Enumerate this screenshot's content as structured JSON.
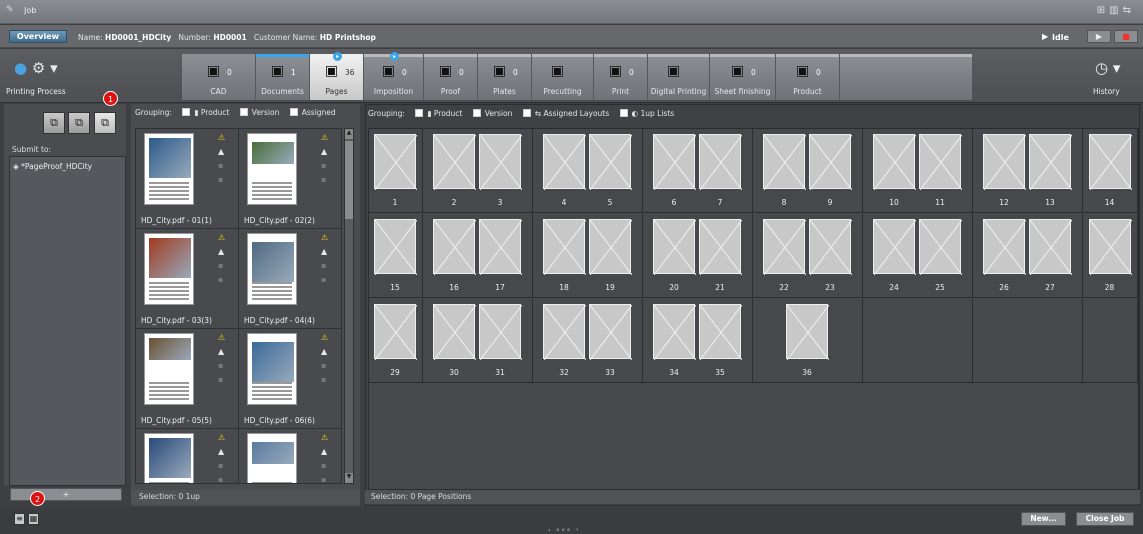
{
  "window": {
    "title": "Job"
  },
  "info": {
    "overview_label": "Overview",
    "name_label": "Name:",
    "name_value": "HD0001_HDCity",
    "number_label": "Number:",
    "number_value": "HD0001",
    "customer_label": "Customer Name:",
    "customer_value": "HD Printshop",
    "status": "Idle"
  },
  "left_button": {
    "label": "Printing Process"
  },
  "history_button": {
    "label": "History"
  },
  "process_steps": [
    {
      "label": "CAD",
      "count": "0",
      "icon": "cad-icon"
    },
    {
      "label": "Documents",
      "count": "1",
      "icon": "documents-icon"
    },
    {
      "label": "Pages",
      "count": "36",
      "icon": "pages-icon",
      "active": true,
      "marker": "▸"
    },
    {
      "label": "Imposition",
      "count": "0",
      "icon": "imposition-icon",
      "marker": "▸"
    },
    {
      "label": "Proof",
      "count": "0",
      "icon": "proof-icon"
    },
    {
      "label": "Plates",
      "count": "0",
      "icon": "plates-icon"
    },
    {
      "label": "Precutting",
      "count": "",
      "icon": "precutting-icon"
    },
    {
      "label": "Print",
      "count": "0",
      "icon": "print-icon"
    },
    {
      "label": "Digital Printing",
      "count": "",
      "icon": "digital-printing-icon"
    },
    {
      "label": "Sheet finishing",
      "count": "0",
      "icon": "sheet-finishing-icon"
    },
    {
      "label": "Product",
      "count": "0",
      "icon": "product-icon"
    }
  ],
  "callouts": {
    "one": "1",
    "two": "2"
  },
  "left": {
    "submit_label": "Submit to:",
    "submit_item": "*PageProof_HDCity",
    "add_label": "+"
  },
  "middle": {
    "grouping_label": "Grouping:",
    "opt_product": "Product",
    "opt_version": "Version",
    "opt_assigned": "Assigned",
    "docs": [
      "HD_City.pdf - 01(1)",
      "HD_City.pdf - 02(2)",
      "HD_City.pdf - 03(3)",
      "HD_City.pdf - 04(4)",
      "HD_City.pdf - 05(5)",
      "HD_City.pdf - 06(6)",
      "",
      ""
    ],
    "selection": "Selection:  0 1up"
  },
  "right": {
    "grouping_label": "Grouping:",
    "opt_product": "Product",
    "opt_version": "Version",
    "opt_assigned_layouts": "Assigned Layouts",
    "opt_1up": "1up Lists",
    "pages": [
      "1",
      "2",
      "3",
      "4",
      "5",
      "6",
      "7",
      "8",
      "9",
      "10",
      "11",
      "12",
      "13",
      "14",
      "15",
      "16",
      "17",
      "18",
      "19",
      "20",
      "21",
      "22",
      "23",
      "24",
      "25",
      "26",
      "27",
      "28",
      "29",
      "30",
      "31",
      "32",
      "33",
      "34",
      "35",
      "36"
    ],
    "selection": "Selection:  0 Page Positions"
  },
  "buttons": {
    "new": "New...",
    "close": "Close Job"
  },
  "colors": {
    "accent": "#39a6e8",
    "callout": "#dd1111"
  }
}
